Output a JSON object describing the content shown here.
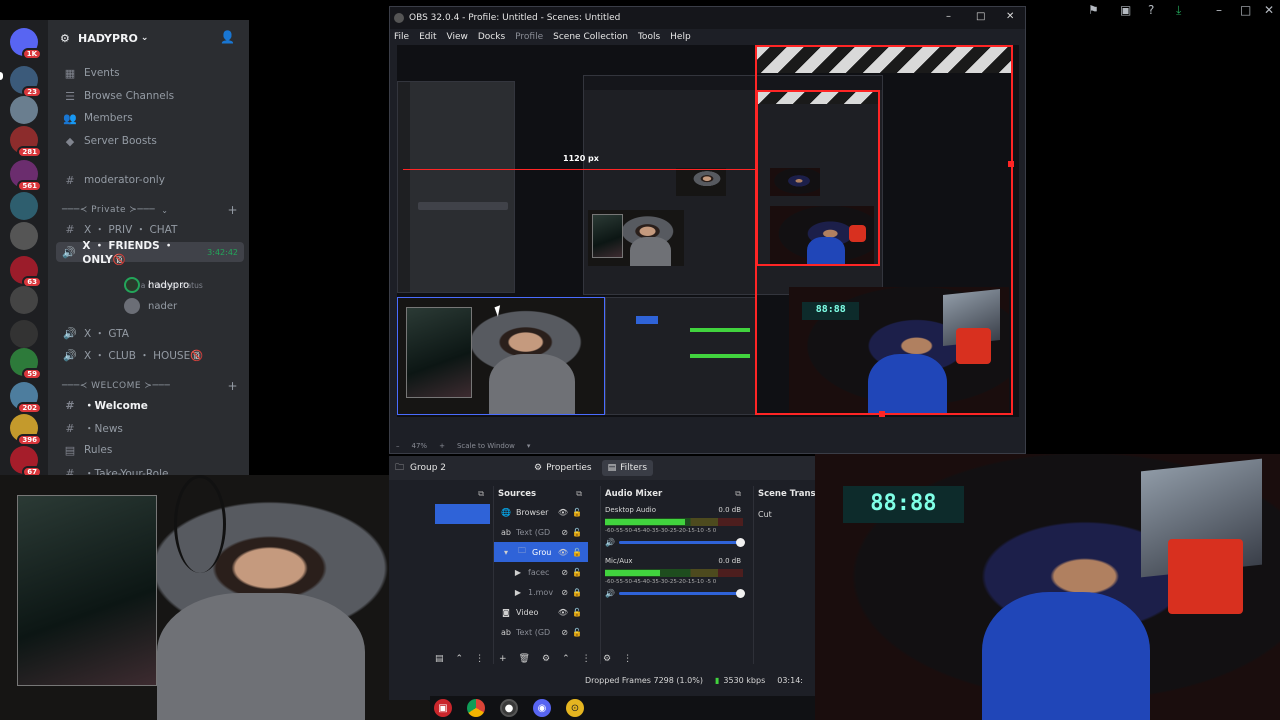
{
  "discord": {
    "server_badges": [
      "1K",
      "23",
      "281",
      "561",
      "63",
      "59",
      "202",
      "396",
      "67"
    ],
    "guild_name": "HADYPRO",
    "channels_top": [
      {
        "icon": "calendar-icon",
        "label": "Events"
      },
      {
        "icon": "browse-icon",
        "label": "Browse Channels"
      },
      {
        "icon": "members-icon",
        "label": "Members"
      },
      {
        "icon": "boost-icon",
        "label": "Server Boosts"
      }
    ],
    "moderator_channel": "moderator-only",
    "category_private": "───≺ Private ≻───",
    "priv_chat": "X ・ PRIV ・ CHAT",
    "friends_only": "X ・ FRIENDS ・ ONLY🔞",
    "friends_time": "3:42:42",
    "channel_status": "Set a channel status",
    "voice_users": [
      "hadypro",
      "nader"
    ],
    "gta": "X ・ GTA",
    "club_house": "X ・ CLUB ・ HOUSE🔞",
    "category_welcome": "───≺ WELCOME ≻───",
    "welcome": "・Welcome",
    "news": "・News",
    "rules": "Rules",
    "take_roles": "・Take-Your-Role"
  },
  "obs": {
    "title": "OBS 32.0.4 - Profile: Untitled - Scenes: Untitled",
    "menu": [
      "File",
      "Edit",
      "View",
      "Docks",
      "Profile",
      "Scene Collection",
      "Tools",
      "Help"
    ],
    "preview_label": "1120 px",
    "zoom": "47%",
    "scale_mode": "Scale to Window",
    "group_label": "Group 2",
    "tab_properties": "Properties",
    "tab_filters": "Filters",
    "sources_title": "Sources",
    "sources": [
      {
        "icon": "globe",
        "label": "Browser"
      },
      {
        "icon": "ab",
        "label": "Text (GD"
      },
      {
        "icon": "folder",
        "label": "Grou"
      },
      {
        "icon": "play",
        "label": "facec"
      },
      {
        "icon": "play",
        "label": "1.mov"
      },
      {
        "icon": "camera",
        "label": "Video"
      },
      {
        "icon": "ab",
        "label": "Text (GD"
      }
    ],
    "mixer_title": "Audio Mixer",
    "mixer": [
      {
        "name": "Desktop Audio",
        "db": "0.0 dB",
        "level": 0.58
      },
      {
        "name": "Mic/Aux",
        "db": "0.0 dB",
        "level": 0.4
      }
    ],
    "meter_scale": "-60-55-50-45-40-35-30-25-20-15-10 -5 0",
    "transitions_title": "Scene Transit",
    "transition": "Cut",
    "dropped_frames": "Dropped Frames 7298 (1.0%)",
    "bitrate": "3530 kbps",
    "uptime": "03:14:"
  },
  "webcam": {
    "clock_text": "88:88"
  },
  "colors": {
    "discord_bg": "#2b2d31",
    "obs_bg": "#1d1f26",
    "selection_blue": "#2f63d8",
    "preview_red": "#ff2525",
    "meter_green": "#41d33e"
  }
}
